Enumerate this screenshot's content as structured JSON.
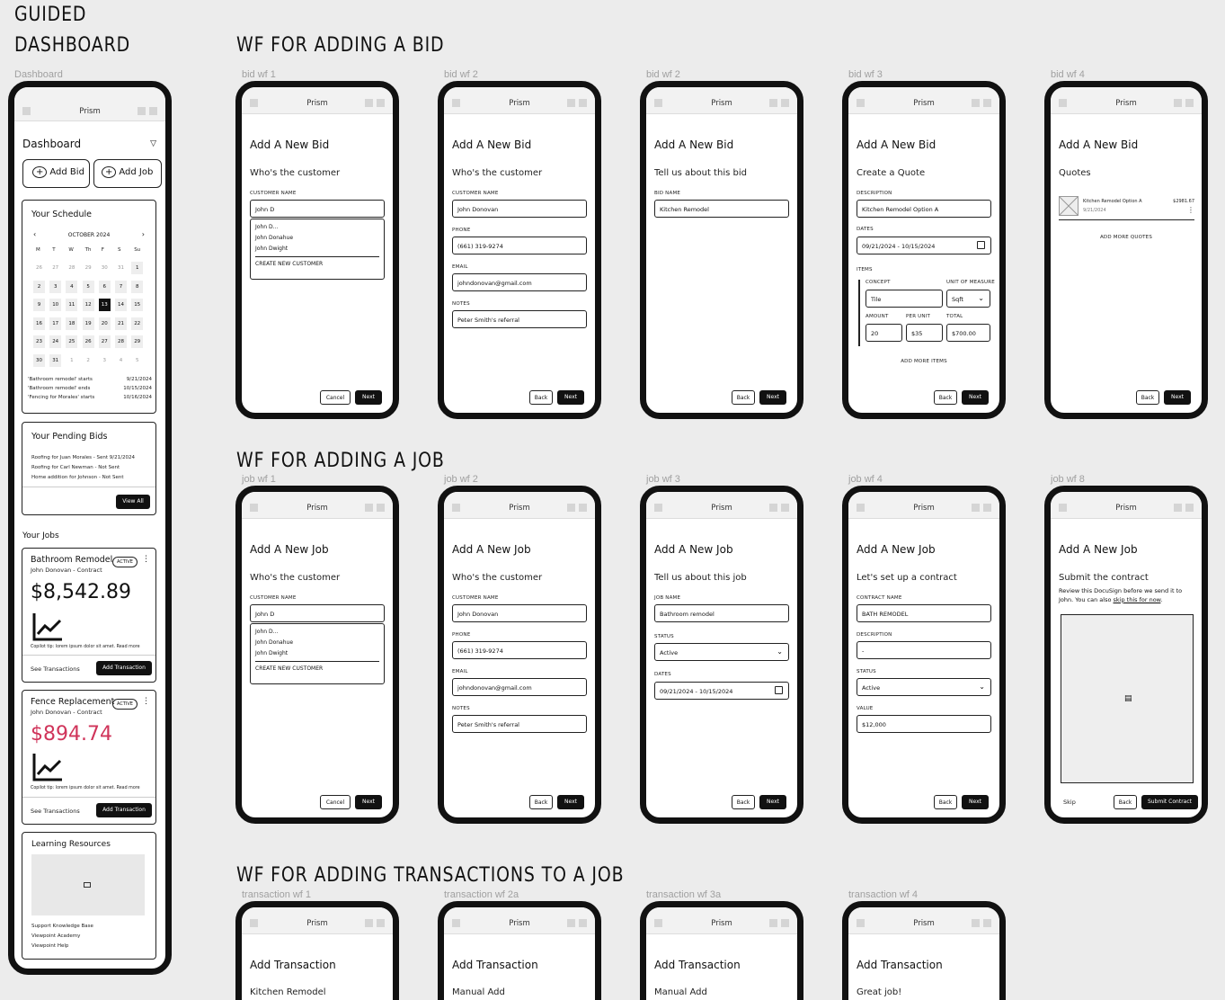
{
  "headings": {
    "guided_line1": "GUIDED",
    "guided_line2": "DASHBOARD",
    "bid": "WF FOR ADDING A BID",
    "job": "WF FOR ADDING A JOB",
    "transactions": "WF FOR ADDING TRANSACTIONS TO A JOB"
  },
  "app_name": "Prism",
  "frame_labels": {
    "dashboard": "Dashboard",
    "bid": [
      "bid wf 1",
      "bid wf 2",
      "bid wf 2",
      "bid wf 3",
      "bid wf 4"
    ],
    "job": [
      "job wf 1",
      "job wf 2",
      "job wf 3",
      "job wf 4",
      "job wf 8"
    ],
    "transaction": [
      "transaction wf 1",
      "transaction wf 2a",
      "transaction wf 3a",
      "transaction wf 4"
    ]
  },
  "dashboard": {
    "title": "Dashboard",
    "add_bid": "Add Bid",
    "add_job": "Add Job",
    "schedule_title": "Your Schedule",
    "month": "OCTOBER 2024",
    "weekdays": [
      "M",
      "T",
      "W",
      "Th",
      "F",
      "S",
      "Su"
    ],
    "calendar_rows": [
      [
        "26",
        "27",
        "28",
        "29",
        "30",
        "31",
        "1"
      ],
      [
        "2",
        "3",
        "4",
        "5",
        "6",
        "7",
        "8"
      ],
      [
        "9",
        "10",
        "11",
        "12",
        "13",
        "14",
        "15"
      ],
      [
        "16",
        "17",
        "18",
        "19",
        "20",
        "21",
        "22"
      ],
      [
        "23",
        "24",
        "25",
        "26",
        "27",
        "28",
        "29"
      ],
      [
        "30",
        "31",
        "1",
        "2",
        "3",
        "4",
        "5"
      ]
    ],
    "events": [
      {
        "text": "'Bathroom remodel' starts",
        "date": "9/21/2024"
      },
      {
        "text": "'Bathroom remodel' ends",
        "date": "10/15/2024"
      },
      {
        "text": "'Fencing for Morales' starts",
        "date": "10/16/2024"
      }
    ],
    "pending_title": "Your Pending Bids",
    "pending": [
      "Roofing for Juan Morales - Sent 9/21/2024",
      "Roofing for Carl Newman - Not Sent",
      "Home addition for Johnson - Not Sent"
    ],
    "view_all": "View All",
    "jobs_title": "Your Jobs",
    "jobs": [
      {
        "name": "Bathroom Remodel",
        "status": "ACTIVE",
        "client": "John Donovan - Contract",
        "amount": "$8,542.89",
        "amount_color": "#111111",
        "tip": "Copilot tip: lorem ipsum dolor sit amet. Read more",
        "see": "See Transactions",
        "add": "Add Transaction"
      },
      {
        "name": "Fence Replacement",
        "status": "ACTIVE",
        "client": "John Donovan - Contract",
        "amount": "$894.74",
        "amount_color": "#d0345a",
        "tip": "Copilot tip: lorem ipsum dolor sit amet. Read more",
        "see": "See Transactions",
        "add": "Add Transaction"
      }
    ],
    "learning_title": "Learning Resources",
    "learning": [
      "Support Knowledge Base",
      "Viewpoint Academy",
      "Viewpoint Help"
    ]
  },
  "bid": {
    "title": "Add A New Bid",
    "wf1": {
      "sub": "Who's the customer",
      "label": "CUSTOMER NAME",
      "value": "John D",
      "options": [
        "John D...",
        "John Donahue",
        "John Dwight"
      ],
      "create": "CREATE NEW CUSTOMER",
      "cancel": "Cancel",
      "next": "Next"
    },
    "wf2": {
      "sub": "Who's the customer",
      "name_label": "CUSTOMER NAME",
      "name": "John Donovan",
      "phone_label": "PHONE",
      "phone": "(661) 319-9274",
      "email_label": "EMAIL",
      "email": "johndonovan@gmail.com",
      "notes_label": "NOTES",
      "notes": "Peter Smith's referral",
      "back": "Back",
      "next": "Next"
    },
    "wf2b": {
      "sub": "Tell us about this bid",
      "label": "BID NAME",
      "value": "Kitchen Remodel",
      "back": "Back",
      "next": "Next"
    },
    "wf3": {
      "sub": "Create a Quote",
      "desc_label": "DESCRIPTION",
      "desc": "Kitchen Remodel Option A",
      "dates_label": "DATES",
      "dates": "09/21/2024  -  10/15/2024",
      "items_label": "ITEMS",
      "concept_label": "CONCEPT",
      "concept": "Tile",
      "uom_label": "UNIT OF MEASURE",
      "uom": "Sqft",
      "amount_label": "AMOUNT",
      "amount": "20",
      "per_unit_label": "PER UNIT",
      "per_unit": "$35",
      "total_label": "TOTAL",
      "total": "$700.00",
      "add_more": "ADD MORE ITEMS",
      "back": "Back",
      "next": "Next"
    },
    "wf4": {
      "sub": "Quotes",
      "quote_name": "Kitchen Remodel Option A",
      "quote_date": "9/21/2024",
      "quote_price": "$2981.67",
      "add_more": "ADD MORE QUOTES",
      "back": "Back",
      "next": "Next"
    }
  },
  "job": {
    "title": "Add A New Job",
    "wf1": {
      "sub": "Who's the customer",
      "label": "CUSTOMER NAME",
      "value": "John D",
      "options": [
        "John D...",
        "John Donahue",
        "John Dwight"
      ],
      "create": "CREATE NEW CUSTOMER",
      "cancel": "Cancel",
      "next": "Next"
    },
    "wf2": {
      "sub": "Who's the customer",
      "name_label": "CUSTOMER NAME",
      "name": "John Donovan",
      "phone_label": "PHONE",
      "phone": "(661) 319-9274",
      "email_label": "EMAIL",
      "email": "johndonovan@gmail.com",
      "notes_label": "NOTES",
      "notes": "Peter Smith's referral",
      "back": "Back",
      "next": "Next"
    },
    "wf3": {
      "sub": "Tell us about this job",
      "name_label": "JOB NAME",
      "name": "Bathroom remodel",
      "status_label": "STATUS",
      "status": "Active",
      "dates_label": "DATES",
      "dates": "09/21/2024  -  10/15/2024",
      "back": "Back",
      "next": "Next"
    },
    "wf4": {
      "sub": "Let's set up a contract",
      "cname_label": "CONTRACT NAME",
      "cname": "BATH REMODEL",
      "desc_label": "DESCRIPTION",
      "desc": "-",
      "status_label": "STATUS",
      "status": "Active",
      "value_label": "VALUE",
      "value": "$12,000",
      "back": "Back",
      "next": "Next"
    },
    "wf8": {
      "sub": "Submit the contract",
      "desc_a": "Review this DocuSign before we send it to John. You can also ",
      "desc_link": "skip this for now",
      "desc_b": ".",
      "skip": "Skip",
      "back": "Back",
      "submit": "Submit Contract"
    }
  },
  "transaction": {
    "title": "Add Transaction",
    "subs": [
      "Kitchen Remodel",
      "Manual Add",
      "Manual Add",
      "Great job!"
    ]
  }
}
